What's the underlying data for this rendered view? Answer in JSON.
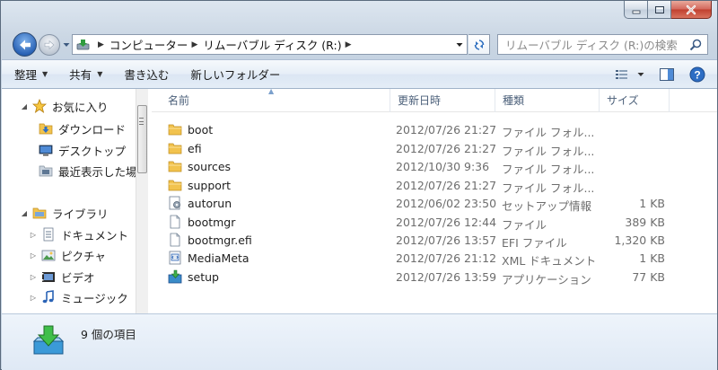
{
  "window": {
    "controls": {
      "minimize": "minimize-icon",
      "maximize": "maximize-icon",
      "close": "close-icon"
    }
  },
  "address": {
    "segments": [
      "コンピューター",
      "リムーバブル ディスク (R:)"
    ],
    "search_placeholder": "リムーバブル ディスク (R:)の検索"
  },
  "toolbar": {
    "organize": "整理",
    "share": "共有",
    "burn": "書き込む",
    "new_folder": "新しいフォルダー"
  },
  "nav": {
    "favorites": "お気に入り",
    "downloads": "ダウンロード",
    "desktop": "デスクトップ",
    "recent": "最近表示した場所",
    "libraries": "ライブラリ",
    "documents": "ドキュメント",
    "pictures": "ピクチャ",
    "videos": "ビデオ",
    "music": "ミュージック"
  },
  "columns": {
    "name": "名前",
    "date": "更新日時",
    "type": "種類",
    "size": "サイズ"
  },
  "files": [
    {
      "name": "boot",
      "date": "2012/07/26 21:27",
      "type": "ファイル フォル...",
      "size": "",
      "icon": "folder"
    },
    {
      "name": "efi",
      "date": "2012/07/26 21:27",
      "type": "ファイル フォル...",
      "size": "",
      "icon": "folder"
    },
    {
      "name": "sources",
      "date": "2012/10/30 9:36",
      "type": "ファイル フォル...",
      "size": "",
      "icon": "folder"
    },
    {
      "name": "support",
      "date": "2012/07/26 21:27",
      "type": "ファイル フォル...",
      "size": "",
      "icon": "folder"
    },
    {
      "name": "autorun",
      "date": "2012/06/02 23:50",
      "type": "セットアップ情報",
      "size": "1 KB",
      "icon": "setup-info"
    },
    {
      "name": "bootmgr",
      "date": "2012/07/26 12:44",
      "type": "ファイル",
      "size": "389 KB",
      "icon": "file"
    },
    {
      "name": "bootmgr.efi",
      "date": "2012/07/26 13:57",
      "type": "EFI ファイル",
      "size": "1,320 KB",
      "icon": "file"
    },
    {
      "name": "MediaMeta",
      "date": "2012/07/26 21:12",
      "type": "XML ドキュメント",
      "size": "1 KB",
      "icon": "xml"
    },
    {
      "name": "setup",
      "date": "2012/07/26 13:59",
      "type": "アプリケーション",
      "size": "77 KB",
      "icon": "setup-app"
    }
  ],
  "details": {
    "item_count": "9 個の項目"
  },
  "colors": {
    "accent": "#2a63b6",
    "folder": "#f2c34e",
    "toolbar": "#e4edf7"
  }
}
